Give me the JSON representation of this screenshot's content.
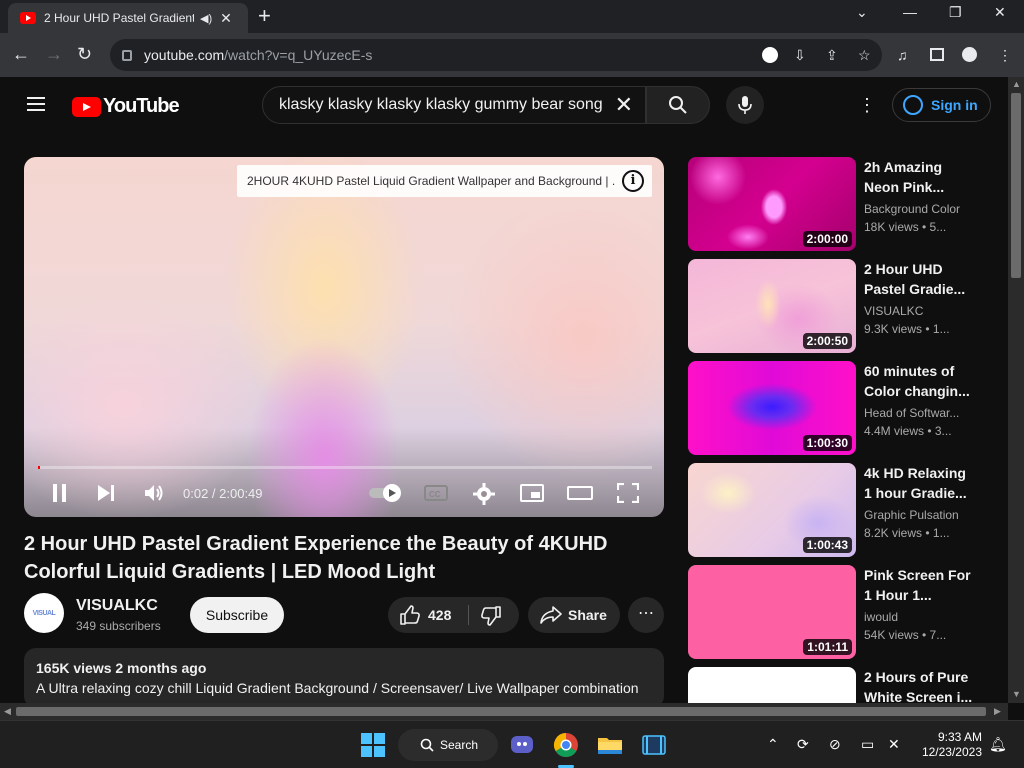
{
  "browser": {
    "tab_title": "2 Hour UHD Pastel Gradient",
    "url_host": "youtube.com",
    "url_path": "/watch?v=q_UYuzecE-s"
  },
  "header": {
    "logo_text": "YouTube",
    "search_query": "klasky klasky klasky klasky gummy bear song",
    "signin_label": "Sign in"
  },
  "player": {
    "info_title": "2HOUR 4KUHD Pastel Liquid Gradient Wallpaper and Background | ...",
    "info_icon": "i",
    "time_display": "0:02 / 2:00:49",
    "progress_fraction": 0.0003
  },
  "video": {
    "title": "2 Hour UHD Pastel Gradient Experience the Beauty of 4KUHD Colorful Liquid Gradients | LED Mood Light",
    "channel_name": "VISUALKC",
    "subscribers": "349 subscribers",
    "subscribe_label": "Subscribe",
    "like_count": "428",
    "share_label": "Share",
    "views_meta": "165K views  2 months ago",
    "description": "A Ultra relaxing cozy chill Liquid Gradient Background / Screensaver/ Live Wallpaper combination"
  },
  "recommendations": [
    {
      "title": "2h Amazing Neon Pink...",
      "channel": "Background Color",
      "stats": "18K views • 5...",
      "duration": "2:00:00"
    },
    {
      "title": "2 Hour UHD Pastel Gradie...",
      "channel": "VISUALKC",
      "stats": "9.3K views • 1...",
      "duration": "2:00:50"
    },
    {
      "title": "60 minutes of Color changin...",
      "channel": "Head of Softwar...",
      "stats": "4.4M views • 3...",
      "duration": "1:00:30"
    },
    {
      "title": "4k HD Relaxing 1 hour Gradie...",
      "channel": "Graphic Pulsation",
      "stats": "8.2K views • 1...",
      "duration": "1:00:43"
    },
    {
      "title": "Pink Screen For 1 Hour 1...",
      "channel": "iwould",
      "stats": "54K views • 7...",
      "duration": "1:01:11"
    },
    {
      "title": "2 Hours of Pure White Screen i...",
      "channel": "",
      "stats": "",
      "duration": ""
    }
  ],
  "taskbar": {
    "search_label": "Search",
    "time": "9:33 AM",
    "date": "12/23/2023"
  },
  "colors": {
    "accent_link": "#3ea6ff",
    "youtube_red": "#ff0000",
    "background": "#0f0f0f"
  }
}
